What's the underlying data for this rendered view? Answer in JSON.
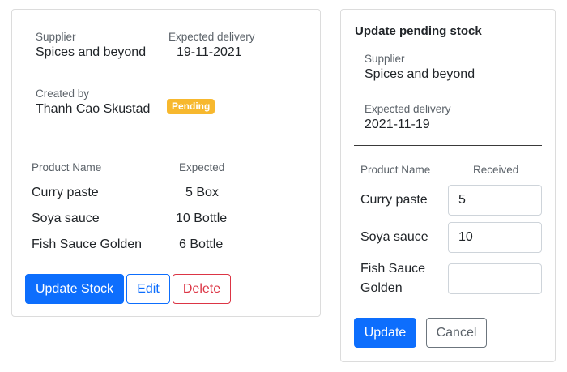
{
  "stock_card": {
    "supplier_label": "Supplier",
    "supplier_value": "Spices and beyond",
    "expected_delivery_label": "Expected delivery",
    "expected_delivery_value": "19-11-2021",
    "created_by_label": "Created by",
    "created_by_value": "Thanh Cao Skustad",
    "status_badge": "Pending",
    "status_color": "#f7b82e",
    "table": {
      "headers": [
        "Product Name",
        "Expected"
      ],
      "rows": [
        {
          "product": "Curry paste",
          "expected": "5 Box"
        },
        {
          "product": "Soya sauce",
          "expected": "10 Bottle"
        },
        {
          "product": "Fish Sauce Golden",
          "expected": "6 Bottle"
        }
      ]
    },
    "buttons": {
      "update_stock": "Update Stock",
      "edit": "Edit",
      "delete": "Delete"
    }
  },
  "update_panel": {
    "title": "Update pending stock",
    "supplier_label": "Supplier",
    "supplier_value": "Spices and beyond",
    "expected_delivery_label": "Expected delivery",
    "expected_delivery_value": "2021-11-19",
    "table": {
      "headers": [
        "Product Name",
        "Received"
      ],
      "rows": [
        {
          "product_line1": "Curry paste",
          "product_line2": "",
          "received": "5"
        },
        {
          "product_line1": "Soya sauce",
          "product_line2": "",
          "received": "10"
        },
        {
          "product_line1": "Fish Sauce",
          "product_line2": "Golden",
          "received": ""
        }
      ]
    },
    "buttons": {
      "update": "Update",
      "cancel": "Cancel"
    }
  },
  "colors": {
    "primary": "#0d6efd",
    "danger": "#dc3545",
    "secondary": "#6c757d"
  }
}
